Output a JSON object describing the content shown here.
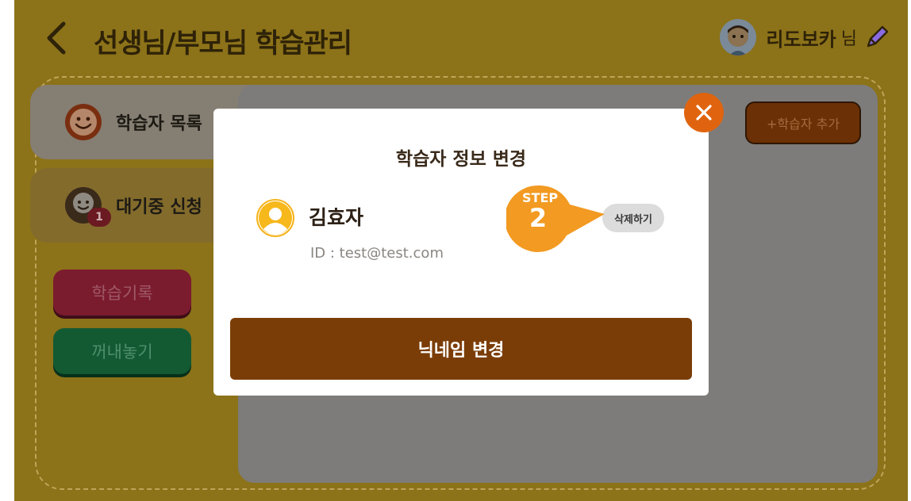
{
  "header": {
    "title": "선생님/부모님 학습관리",
    "user_name": "리도보카",
    "user_suffix": "님"
  },
  "sidebar": {
    "learner_list_label": "학습자 목록",
    "pending_label": "대기중 신청",
    "pending_count": "1",
    "record_button": "학습기록",
    "takeout_button": "꺼내놓기"
  },
  "main": {
    "add_learner_button": "+학습자 추가"
  },
  "modal": {
    "title": "학습자 정보 변경",
    "learner_name": "김효자",
    "learner_id": "ID : test@test.com",
    "delete_button": "삭제하기",
    "nickname_button": "닉네임 변경"
  },
  "step_callout": {
    "word": "STEP",
    "number": "2"
  },
  "colors": {
    "background_dim": "#8c7219",
    "modal_button": "#7b3d08",
    "close_button": "#e0640f",
    "step_callout": "#f29a21"
  }
}
